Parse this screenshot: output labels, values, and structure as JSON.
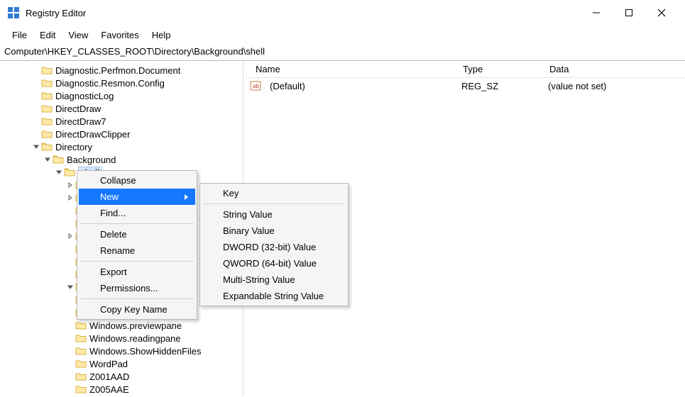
{
  "app": {
    "title": "Registry Editor"
  },
  "menubar": {
    "file": "File",
    "edit": "Edit",
    "view": "View",
    "favorites": "Favorites",
    "help": "Help"
  },
  "addressbar": {
    "path": "Computer\\HKEY_CLASSES_ROOT\\Directory\\Background\\shell"
  },
  "tree": {
    "items": [
      {
        "indent": 44,
        "toggle": "none",
        "label": "Diagnostic.Perfmon.Document"
      },
      {
        "indent": 44,
        "toggle": "none",
        "label": "Diagnostic.Resmon.Config"
      },
      {
        "indent": 44,
        "toggle": "none",
        "label": "DiagnosticLog"
      },
      {
        "indent": 44,
        "toggle": "none",
        "label": "DirectDraw"
      },
      {
        "indent": 44,
        "toggle": "none",
        "label": "DirectDraw7"
      },
      {
        "indent": 44,
        "toggle": "none",
        "label": "DirectDrawClipper"
      },
      {
        "indent": 44,
        "toggle": "expanded",
        "label": "Directory"
      },
      {
        "indent": 60,
        "toggle": "expanded",
        "label": "Background"
      },
      {
        "indent": 76,
        "toggle": "expanded",
        "label": "shell",
        "selected": true
      },
      {
        "indent": 92,
        "toggle": "collapsed",
        "label": ""
      },
      {
        "indent": 92,
        "toggle": "collapsed",
        "label": ""
      },
      {
        "indent": 92,
        "toggle": "none",
        "label": ""
      },
      {
        "indent": 92,
        "toggle": "none",
        "label": ""
      },
      {
        "indent": 92,
        "toggle": "collapsed",
        "label": ""
      },
      {
        "indent": 92,
        "toggle": "none",
        "label": ""
      },
      {
        "indent": 92,
        "toggle": "none",
        "label": ""
      },
      {
        "indent": 92,
        "toggle": "none",
        "label": ""
      },
      {
        "indent": 92,
        "toggle": "expanded",
        "label": ""
      },
      {
        "indent": 92,
        "toggle": "none",
        "label": ""
      },
      {
        "indent": 92,
        "toggle": "none",
        "label": ""
      },
      {
        "indent": 92,
        "toggle": "none",
        "label": "Windows.previewpane"
      },
      {
        "indent": 92,
        "toggle": "none",
        "label": "Windows.readingpane"
      },
      {
        "indent": 92,
        "toggle": "none",
        "label": "Windows.ShowHiddenFiles"
      },
      {
        "indent": 92,
        "toggle": "none",
        "label": "WordPad"
      },
      {
        "indent": 92,
        "toggle": "none",
        "label": "Z001AAD"
      },
      {
        "indent": 92,
        "toggle": "none",
        "label": "Z005AAE"
      }
    ]
  },
  "list": {
    "headers": {
      "name": "Name",
      "type": "Type",
      "data": "Data"
    },
    "rows": [
      {
        "name": "(Default)",
        "type": "REG_SZ",
        "data": "(value not set)"
      }
    ]
  },
  "contextMenu": {
    "collapse": "Collapse",
    "new": "New",
    "find": "Find...",
    "delete": "Delete",
    "rename": "Rename",
    "export": "Export",
    "permissions": "Permissions...",
    "copyKeyName": "Copy Key Name"
  },
  "newSubmenu": {
    "key": "Key",
    "stringValue": "String Value",
    "binaryValue": "Binary Value",
    "dword": "DWORD (32-bit) Value",
    "qword": "QWORD (64-bit) Value",
    "multiString": "Multi-String Value",
    "expandableString": "Expandable String Value"
  }
}
